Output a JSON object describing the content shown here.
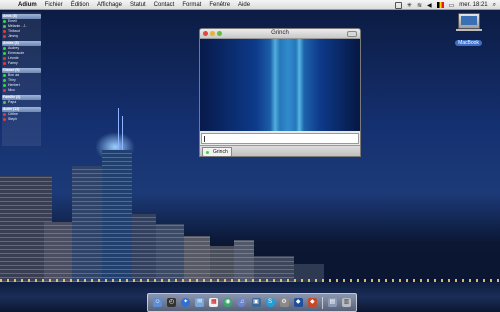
{
  "menubar": {
    "apple": "",
    "items": [
      "Adium",
      "Fichier",
      "Édition",
      "Affichage",
      "Statut",
      "Contact",
      "Format",
      "Fenêtre",
      "Aide"
    ],
    "clock": "mer. 18:21"
  },
  "buddy_list": {
    "groups": [
      {
        "name": "Amis (8)",
        "contacts": [
          {
            "name": "Emeil",
            "status": "green"
          },
          {
            "name": "Mélanie - J..",
            "status": "green"
          },
          {
            "name": "Thibaut",
            "status": "red"
          },
          {
            "name": "Jimmy",
            "status": "red"
          }
        ]
      },
      {
        "name": "Amies (5)",
        "contacts": [
          {
            "name": "Audrey",
            "status": "green"
          },
          {
            "name": "Emeraude",
            "status": "green"
          },
          {
            "name": "Léonie",
            "status": "red"
          },
          {
            "name": "Fanny",
            "status": "red"
          }
        ]
      },
      {
        "name": "Classe (9)",
        "contacts": [
          {
            "name": "Bon aa",
            "status": "green"
          },
          {
            "name": "Thiry",
            "status": "green"
          },
          {
            "name": "Herbert",
            "status": "green"
          },
          {
            "name": "Nico",
            "status": "red"
          }
        ]
      },
      {
        "name": "Famille (2)",
        "contacts": [
          {
            "name": "Papa",
            "status": "green"
          }
        ]
      },
      {
        "name": "Autre (12)",
        "contacts": [
          {
            "name": "Céline",
            "status": "red"
          },
          {
            "name": "Steph",
            "status": "red"
          }
        ]
      }
    ]
  },
  "chat_window": {
    "title": "Grinch",
    "tab_label": "Grinch"
  },
  "desktop": {
    "drive_label": "MacBook"
  },
  "dock": {
    "items": [
      "finder-icon",
      "dashboard-icon",
      "safari-icon",
      "mail-icon",
      "ical-icon",
      "adium-icon",
      "itunes-icon",
      "iphoto-icon",
      "skype-icon",
      "preferences-icon",
      "app-icon",
      "app-icon",
      "documents-icon",
      "trash-icon"
    ]
  }
}
